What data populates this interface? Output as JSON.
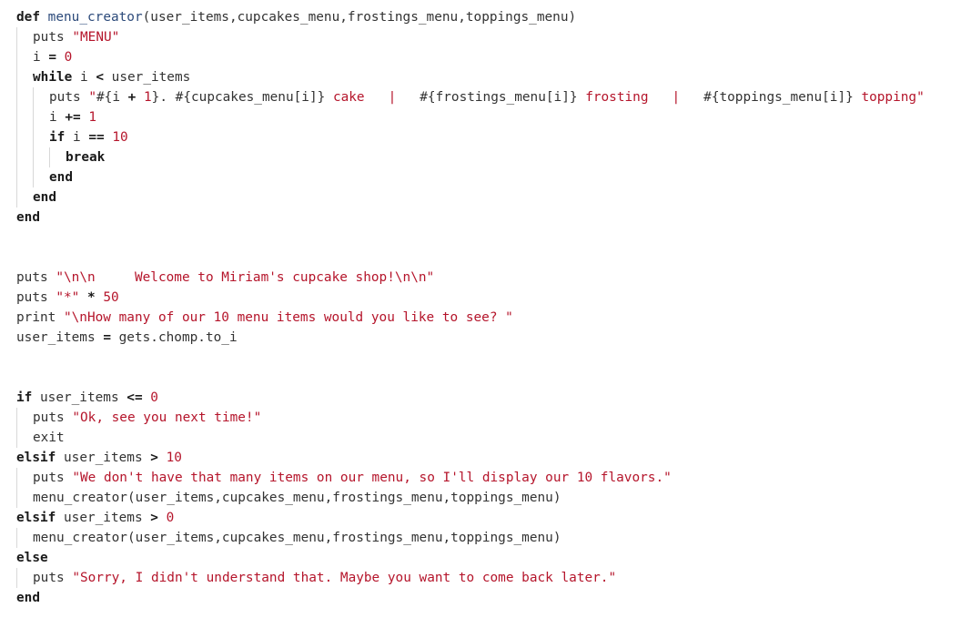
{
  "editor": {
    "lines": [
      {
        "indent": 0,
        "tokens": [
          {
            "t": "def",
            "k": "keyword"
          },
          {
            "t": " ",
            "k": "plain"
          },
          {
            "t": "menu_creator",
            "k": "function"
          },
          {
            "t": "(user_items,cupcakes_menu,frostings_menu,toppings_menu)",
            "k": "plain"
          }
        ]
      },
      {
        "indent": 1,
        "tokens": [
          {
            "t": "puts ",
            "k": "plain"
          },
          {
            "t": "\"MENU\"",
            "k": "string"
          }
        ]
      },
      {
        "indent": 1,
        "tokens": [
          {
            "t": "i ",
            "k": "plain"
          },
          {
            "t": "=",
            "k": "op"
          },
          {
            "t": " ",
            "k": "plain"
          },
          {
            "t": "0",
            "k": "number"
          }
        ]
      },
      {
        "indent": 1,
        "tokens": [
          {
            "t": "while",
            "k": "keyword"
          },
          {
            "t": " i ",
            "k": "plain"
          },
          {
            "t": "<",
            "k": "op"
          },
          {
            "t": " user_items",
            "k": "plain"
          }
        ]
      },
      {
        "indent": 2,
        "tokens": [
          {
            "t": "puts ",
            "k": "plain"
          },
          {
            "t": "\"",
            "k": "string"
          },
          {
            "t": "#{i ",
            "k": "plain"
          },
          {
            "t": "+",
            "k": "op"
          },
          {
            "t": " ",
            "k": "plain"
          },
          {
            "t": "1",
            "k": "number"
          },
          {
            "t": "}. #{cupcakes_menu[i]}",
            "k": "plain"
          },
          {
            "t": " cake   |   ",
            "k": "string"
          },
          {
            "t": "#{frostings_menu[i]}",
            "k": "plain"
          },
          {
            "t": " frosting   |   ",
            "k": "string"
          },
          {
            "t": "#{toppings_menu[i]}",
            "k": "plain"
          },
          {
            "t": " topping\"",
            "k": "string"
          }
        ]
      },
      {
        "indent": 2,
        "tokens": [
          {
            "t": "i ",
            "k": "plain"
          },
          {
            "t": "+=",
            "k": "op"
          },
          {
            "t": " ",
            "k": "plain"
          },
          {
            "t": "1",
            "k": "number"
          }
        ]
      },
      {
        "indent": 2,
        "tokens": [
          {
            "t": "if",
            "k": "keyword"
          },
          {
            "t": " i ",
            "k": "plain"
          },
          {
            "t": "==",
            "k": "op"
          },
          {
            "t": " ",
            "k": "plain"
          },
          {
            "t": "10",
            "k": "number"
          }
        ]
      },
      {
        "indent": 3,
        "tokens": [
          {
            "t": "break",
            "k": "keyword"
          }
        ]
      },
      {
        "indent": 2,
        "tokens": [
          {
            "t": "end",
            "k": "keyword"
          }
        ]
      },
      {
        "indent": 1,
        "tokens": [
          {
            "t": "end",
            "k": "keyword"
          }
        ]
      },
      {
        "indent": 0,
        "tokens": [
          {
            "t": "end",
            "k": "keyword"
          }
        ]
      },
      {
        "indent": 0,
        "tokens": []
      },
      {
        "indent": 0,
        "tokens": []
      },
      {
        "indent": 0,
        "tokens": [
          {
            "t": "puts ",
            "k": "plain"
          },
          {
            "t": "\"\\n\\n     Welcome to Miriam's cupcake shop!\\n\\n\"",
            "k": "string"
          }
        ]
      },
      {
        "indent": 0,
        "tokens": [
          {
            "t": "puts ",
            "k": "plain"
          },
          {
            "t": "\"*\"",
            "k": "string"
          },
          {
            "t": " ",
            "k": "plain"
          },
          {
            "t": "*",
            "k": "op"
          },
          {
            "t": " ",
            "k": "plain"
          },
          {
            "t": "50",
            "k": "number"
          }
        ]
      },
      {
        "indent": 0,
        "tokens": [
          {
            "t": "print ",
            "k": "plain"
          },
          {
            "t": "\"\\nHow many of our 10 menu items would you like to see? \"",
            "k": "string"
          }
        ]
      },
      {
        "indent": 0,
        "tokens": [
          {
            "t": "user_items ",
            "k": "plain"
          },
          {
            "t": "=",
            "k": "op"
          },
          {
            "t": " gets.chomp.to_i",
            "k": "plain"
          }
        ]
      },
      {
        "indent": 0,
        "tokens": []
      },
      {
        "indent": 0,
        "tokens": []
      },
      {
        "indent": 0,
        "tokens": [
          {
            "t": "if",
            "k": "keyword"
          },
          {
            "t": " user_items ",
            "k": "plain"
          },
          {
            "t": "<=",
            "k": "op"
          },
          {
            "t": " ",
            "k": "plain"
          },
          {
            "t": "0",
            "k": "number"
          }
        ]
      },
      {
        "indent": 1,
        "tokens": [
          {
            "t": "puts ",
            "k": "plain"
          },
          {
            "t": "\"Ok, see you next time!\"",
            "k": "string"
          }
        ]
      },
      {
        "indent": 1,
        "tokens": [
          {
            "t": "exit",
            "k": "plain"
          }
        ]
      },
      {
        "indent": 0,
        "tokens": [
          {
            "t": "elsif",
            "k": "keyword"
          },
          {
            "t": " user_items ",
            "k": "plain"
          },
          {
            "t": ">",
            "k": "op"
          },
          {
            "t": " ",
            "k": "plain"
          },
          {
            "t": "10",
            "k": "number"
          }
        ]
      },
      {
        "indent": 1,
        "tokens": [
          {
            "t": "puts ",
            "k": "plain"
          },
          {
            "t": "\"We don't have that many items on our menu, so I'll display our 10 flavors.\"",
            "k": "string"
          }
        ]
      },
      {
        "indent": 1,
        "tokens": [
          {
            "t": "menu_creator(user_items,cupcakes_menu,frostings_menu,toppings_menu)",
            "k": "plain"
          }
        ]
      },
      {
        "indent": 0,
        "tokens": [
          {
            "t": "elsif",
            "k": "keyword"
          },
          {
            "t": " user_items ",
            "k": "plain"
          },
          {
            "t": ">",
            "k": "op"
          },
          {
            "t": " ",
            "k": "plain"
          },
          {
            "t": "0",
            "k": "number"
          }
        ]
      },
      {
        "indent": 1,
        "tokens": [
          {
            "t": "menu_creator(user_items,cupcakes_menu,frostings_menu,toppings_menu)",
            "k": "plain"
          }
        ]
      },
      {
        "indent": 0,
        "tokens": [
          {
            "t": "else",
            "k": "keyword"
          }
        ]
      },
      {
        "indent": 1,
        "tokens": [
          {
            "t": "puts ",
            "k": "plain"
          },
          {
            "t": "\"Sorry, I didn't understand that. Maybe you want to come back later.\"",
            "k": "string"
          }
        ]
      },
      {
        "indent": 0,
        "tokens": [
          {
            "t": "end",
            "k": "keyword"
          }
        ]
      }
    ]
  }
}
